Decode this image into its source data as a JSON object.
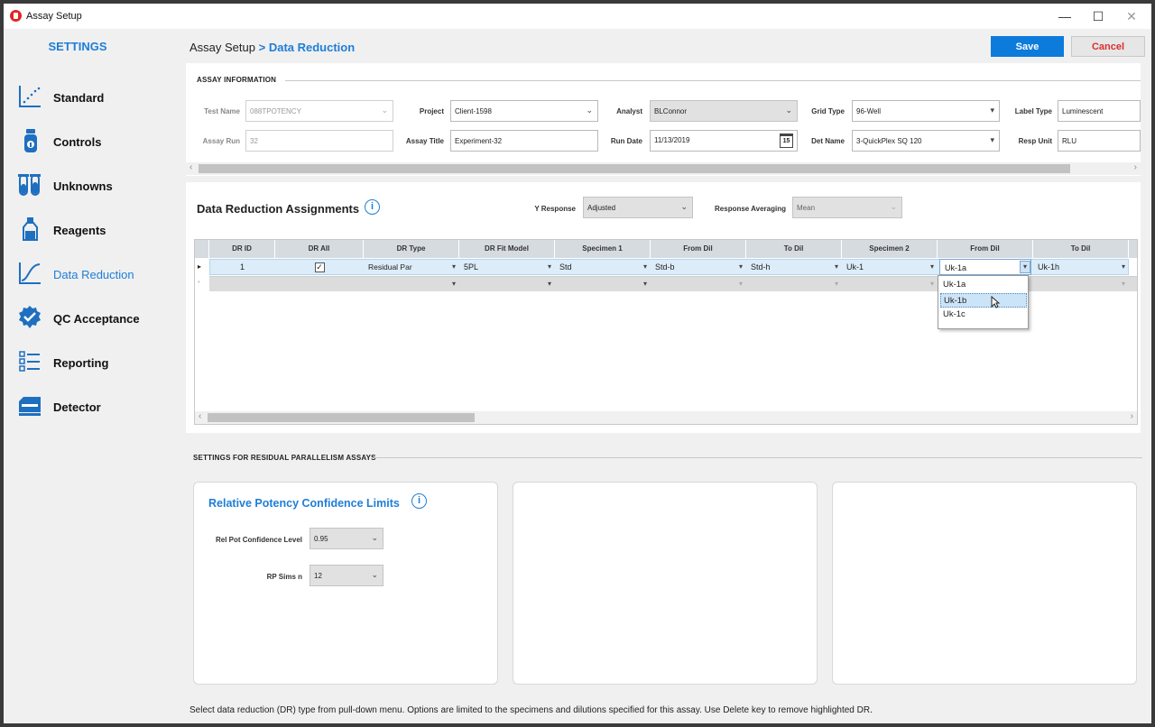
{
  "window": {
    "title": "Assay Setup",
    "controls": [
      "—",
      "☐",
      "✕"
    ]
  },
  "sidebar": {
    "title": "SETTINGS",
    "items": [
      {
        "label": "Standard",
        "icon": "standard-curve-icon"
      },
      {
        "label": "Controls",
        "icon": "vial-icon"
      },
      {
        "label": "Unknowns",
        "icon": "test-tubes-icon"
      },
      {
        "label": "Reagents",
        "icon": "bottle-icon"
      },
      {
        "label": "Data Reduction",
        "icon": "curve-icon",
        "active": true
      },
      {
        "label": "QC Acceptance",
        "icon": "badge-check-icon"
      },
      {
        "label": "Reporting",
        "icon": "checklist-icon"
      },
      {
        "label": "Detector",
        "icon": "detector-icon"
      }
    ]
  },
  "header": {
    "breadcrumb_root": "Assay Setup",
    "breadcrumb_current": "> Data Reduction",
    "save": "Save",
    "cancel": "Cancel"
  },
  "assay_info": {
    "title": "ASSAY INFORMATION",
    "test_name": {
      "label": "Test Name",
      "value": "088TPOTENCY"
    },
    "assay_run": {
      "label": "Assay Run",
      "value": "32"
    },
    "project": {
      "label": "Project",
      "value": "Client-1598"
    },
    "assay_title": {
      "label": "Assay Title",
      "value": "Experiment-32"
    },
    "analyst": {
      "label": "Analyst",
      "value": "BLConnor"
    },
    "run_date": {
      "label": "Run Date",
      "value": "11/13/2019",
      "cal": "15"
    },
    "grid_type": {
      "label": "Grid Type",
      "value": "96-Well"
    },
    "det_name": {
      "label": "Det Name",
      "value": "3-QuickPlex SQ 120"
    },
    "label_type": {
      "label": "Label Type",
      "value": "Luminescent"
    },
    "resp_unit": {
      "label": "Resp Unit",
      "value": "RLU"
    }
  },
  "dr": {
    "title": "Data Reduction Assignments",
    "info": "i",
    "y_response": {
      "label": "Y Response",
      "value": "Adjusted"
    },
    "resp_avg": {
      "label": "Response Averaging",
      "value": "Mean"
    },
    "columns": [
      "DR ID",
      "DR All",
      "DR Type",
      "DR Fit Model",
      "Specimen 1",
      "From Dil",
      "To Dil",
      "Specimen 2",
      "From Dil",
      "To Dil"
    ],
    "row": {
      "dr_id": "1",
      "dr_all": "✓",
      "dr_type": "Residual Par",
      "fit_model": "5PL",
      "spec1": "Std",
      "from1": "Std-b",
      "to1": "Std-h",
      "spec2": "Uk-1",
      "from2": "Uk-1a",
      "to2": "Uk-1h"
    },
    "options": [
      "Uk-1a",
      "Uk-1b",
      "Uk-1c"
    ]
  },
  "rp": {
    "section": "SETTINGS FOR RESIDUAL PARALLELISM ASSAYS",
    "title": "Relative Potency Confidence Limits",
    "info": "i",
    "conf_level": {
      "label": "Rel Pot Confidence Level",
      "value": "0.95"
    },
    "sims": {
      "label": "RP Sims n",
      "value": "12"
    }
  },
  "footer": "Select data reduction (DR) type from pull-down menu.  Options are limited to the specimens and dilutions specified for this assay. Use Delete key to remove highlighted DR."
}
